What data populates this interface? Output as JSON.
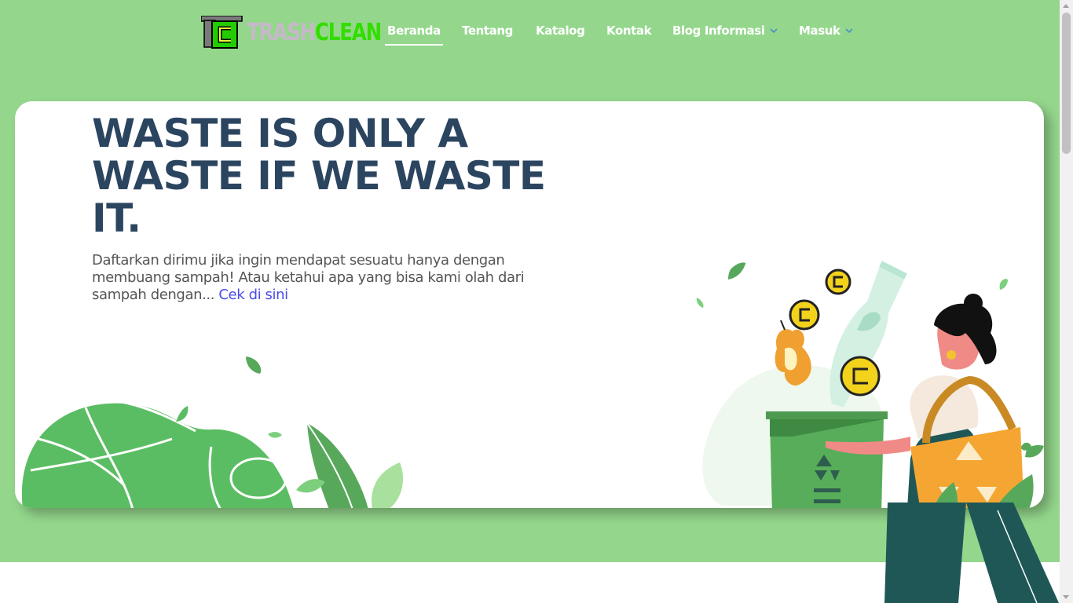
{
  "brand": {
    "part1": "TRASH",
    "part2": "CLEAN",
    "mark_letters": "TC"
  },
  "nav": {
    "items": [
      {
        "label": "Beranda",
        "active": true,
        "dropdown": false
      },
      {
        "label": "Tentang",
        "active": false,
        "dropdown": false
      },
      {
        "label": "Katalog",
        "active": false,
        "dropdown": false
      },
      {
        "label": "Kontak",
        "active": false,
        "dropdown": false
      },
      {
        "label": "Blog Informasi",
        "active": false,
        "dropdown": true
      },
      {
        "label": "Masuk",
        "active": false,
        "dropdown": true
      }
    ],
    "dropdown_icon": "chevron-down-icon"
  },
  "hero": {
    "headline_line1": "WASTE IS ONLY A",
    "headline_line2": "WASTE IF WE WASTE",
    "headline_line3": "IT.",
    "lead": "Daftarkan dirimu jika ingin mendapat sesuatu hanya dengan membuang sampah! Atau ketahui apa yang bisa kami olah dari sampah dengan... ",
    "link_text": "Cek di sini"
  },
  "colors": {
    "band": "#94d78c",
    "headline": "#2b4560",
    "link": "#4a4ce6",
    "bin": "#57ad5a",
    "bag": "#f5a632",
    "coin": "#f2d21b"
  }
}
